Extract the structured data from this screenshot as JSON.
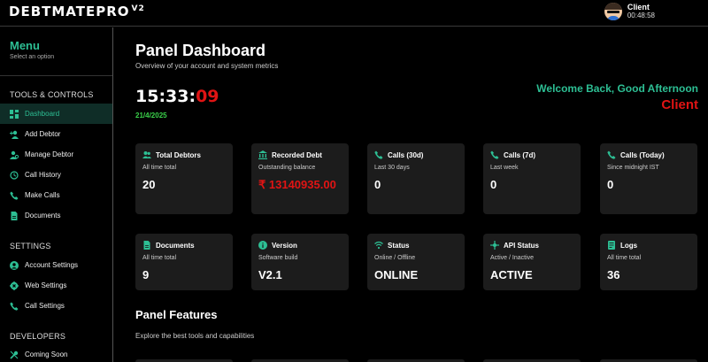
{
  "app": {
    "brand": "DEBTMATEPRO",
    "brand_version": "V2"
  },
  "user": {
    "name": "Client",
    "time": "00:48:58"
  },
  "sidebar": {
    "title": "Menu",
    "subtitle": "Select an option",
    "sections": [
      {
        "label": "TOOLS & CONTROLS",
        "items": [
          {
            "label": "Dashboard",
            "icon": "dashboard-icon",
            "active": true
          },
          {
            "label": "Add Debtor",
            "icon": "user-plus-icon"
          },
          {
            "label": "Manage Debtor",
            "icon": "users-gear-icon"
          },
          {
            "label": "Call History",
            "icon": "history-icon"
          },
          {
            "label": "Make Calls",
            "icon": "phone-icon"
          },
          {
            "label": "Documents",
            "icon": "document-icon"
          }
        ]
      },
      {
        "label": "SETTINGS",
        "items": [
          {
            "label": "Account Settings",
            "icon": "user-circle-icon"
          },
          {
            "label": "Web Settings",
            "icon": "gear-icon"
          },
          {
            "label": "Call Settings",
            "icon": "phone-gear-icon"
          }
        ]
      },
      {
        "label": "DEVELOPERS",
        "items": [
          {
            "label": "Coming Soon",
            "icon": "tools-icon"
          }
        ]
      }
    ]
  },
  "main": {
    "title": "Panel Dashboard",
    "subtitle": "Overview of your account and system metrics",
    "clock": {
      "hm": "15:33:",
      "sec": "09"
    },
    "date": "21/4/2025",
    "welcome": "Welcome Back, Good Afternoon",
    "client": "Client",
    "cards": [
      {
        "title": "Total Debtors",
        "desc": "All time total",
        "value": "20",
        "icon": "users-icon"
      },
      {
        "title": "Recorded Debt",
        "desc": "Outstanding balance",
        "value": "₹ 13140935.00",
        "icon": "bank-icon"
      },
      {
        "title": "Calls (30d)",
        "desc": "Last 30 days",
        "value": "0",
        "icon": "phone-icon"
      },
      {
        "title": "Calls (7d)",
        "desc": "Last week",
        "value": "0",
        "icon": "phone-icon"
      },
      {
        "title": "Calls (Today)",
        "desc": "Since midnight IST",
        "value": "0",
        "icon": "phone-icon"
      },
      {
        "title": "Documents",
        "desc": "All time total",
        "value": "9",
        "icon": "document-icon"
      },
      {
        "title": "Version",
        "desc": "Software build",
        "value": "V2.1",
        "icon": "info-icon"
      },
      {
        "title": "Status",
        "desc": "Online / Offline",
        "value": "ONLINE",
        "icon": "wifi-icon"
      },
      {
        "title": "API Status",
        "desc": "Active / Inactive",
        "value": "ACTIVE",
        "icon": "api-icon"
      },
      {
        "title": "Logs",
        "desc": "All time total",
        "value": "36",
        "icon": "logs-icon"
      }
    ],
    "features_title": "Panel Features",
    "features_subtitle": "Explore the best tools and capabilities"
  },
  "colors": {
    "accent": "#2dbf94",
    "danger": "#e01414",
    "date": "#3ad24a",
    "card_bg": "#1c1c1c"
  }
}
